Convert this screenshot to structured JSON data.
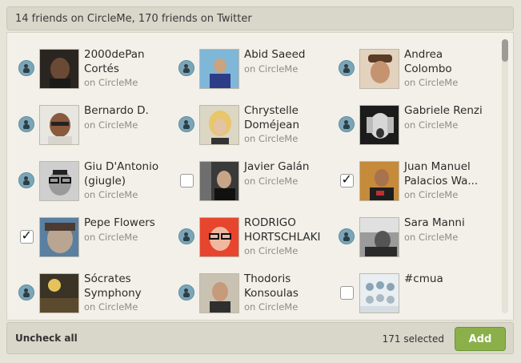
{
  "header": {
    "title": "14 friends on CircleMe, 170 friends on Twitter"
  },
  "friends": [
    {
      "name": "2000dePan Cortés",
      "source": "on CircleMe",
      "marker": "circleme-icon"
    },
    {
      "name": "Abid Saeed",
      "source": "on CircleMe",
      "marker": "circleme-icon"
    },
    {
      "name": "Andrea Colombo",
      "source": "on CircleMe",
      "marker": "circleme-icon"
    },
    {
      "name": "Bernardo D.",
      "source": "on CircleMe",
      "marker": "circleme-icon"
    },
    {
      "name": "Chrystelle Doméjean",
      "source": "on CircleMe",
      "marker": "circleme-icon"
    },
    {
      "name": "Gabriele Renzi",
      "source": "on CircleMe",
      "marker": "circleme-icon"
    },
    {
      "name": "Giu D'Antonio (giugle)",
      "source": "on CircleMe",
      "marker": "circleme-icon"
    },
    {
      "name": "Javier Galán",
      "source": "on CircleMe",
      "marker": "checkbox",
      "checked": false
    },
    {
      "name": "Juan Manuel Palacios Wa...",
      "source": "on CircleMe",
      "marker": "checkbox",
      "checked": true
    },
    {
      "name": "Pepe Flowers",
      "source": "on CircleMe",
      "marker": "checkbox",
      "checked": true
    },
    {
      "name": "RODRIGO HORTSCHLAKI",
      "source": "on CircleMe",
      "marker": "circleme-icon"
    },
    {
      "name": "Sara Manni",
      "source": "on CircleMe",
      "marker": "circleme-icon"
    },
    {
      "name": "Sócrates Symphony",
      "source": "on CircleMe",
      "marker": "circleme-icon"
    },
    {
      "name": "Thodoris Konsoulas",
      "source": "on CircleMe",
      "marker": "circleme-icon"
    },
    {
      "name": "#cmua",
      "source": "",
      "marker": "checkbox",
      "checked": false
    }
  ],
  "footer": {
    "uncheck_label": "Uncheck all",
    "selected_label": "171 selected",
    "add_label": "Add"
  },
  "colors": {
    "add_button": "#8bb04a",
    "circleme_icon": "#7aa6b8"
  }
}
